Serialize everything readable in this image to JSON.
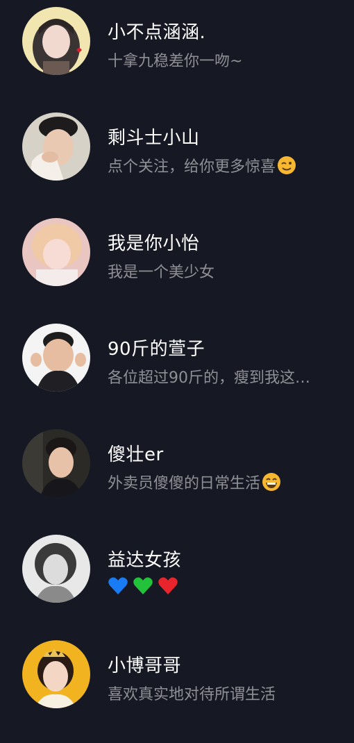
{
  "users": [
    {
      "name": "小不点涵涵.",
      "bio": "十拿九稳差你一吻~"
    },
    {
      "name": "剩斗士小山",
      "bio": "点个关注，给你更多惊喜",
      "emoji": "wink-emoji"
    },
    {
      "name": "我是你小怡",
      "bio": "我是一个美少女"
    },
    {
      "name": "90斤的萱子",
      "bio": "各位超过90斤的，瘦到我这…"
    },
    {
      "name": "傻壮er",
      "bio": "外卖员傻傻的日常生活",
      "emoji": "grin-emoji"
    },
    {
      "name": "益达女孩",
      "bio": "",
      "hearts": [
        "#1a7cf5",
        "#22c33a",
        "#e8252c"
      ]
    },
    {
      "name": "小博哥哥",
      "bio": "喜欢真实地对待所谓生活"
    }
  ]
}
